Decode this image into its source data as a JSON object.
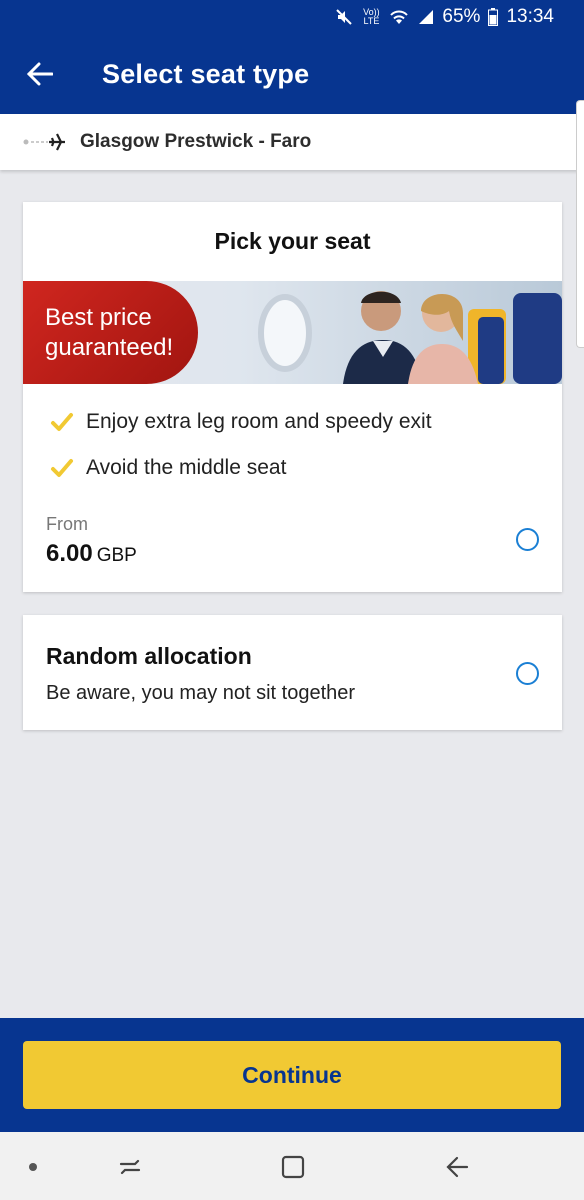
{
  "status_bar": {
    "volte": "Vo)) LTE",
    "battery": "65%",
    "time": "13:34"
  },
  "app_bar": {
    "title": "Select seat type",
    "back_icon": "arrow-left-icon"
  },
  "route": {
    "text": "Glasgow Prestwick - Faro",
    "icon": "plane-icon"
  },
  "pick_seat_card": {
    "title": "Pick your seat",
    "banner_text_line1": "Best price",
    "banner_text_line2": "guaranteed!",
    "benefits": [
      "Enjoy extra leg room and speedy exit",
      "Avoid the middle seat"
    ],
    "from_label": "From",
    "price": "6.00",
    "currency": "GBP"
  },
  "random_card": {
    "title": "Random allocation",
    "subtitle": "Be aware, you may not sit together"
  },
  "continue_button": {
    "label": "Continue"
  },
  "colors": {
    "brand_blue": "#073590",
    "accent_yellow": "#f1c933",
    "radio_blue": "#1a7fd4",
    "banner_red": "#d0261f"
  }
}
